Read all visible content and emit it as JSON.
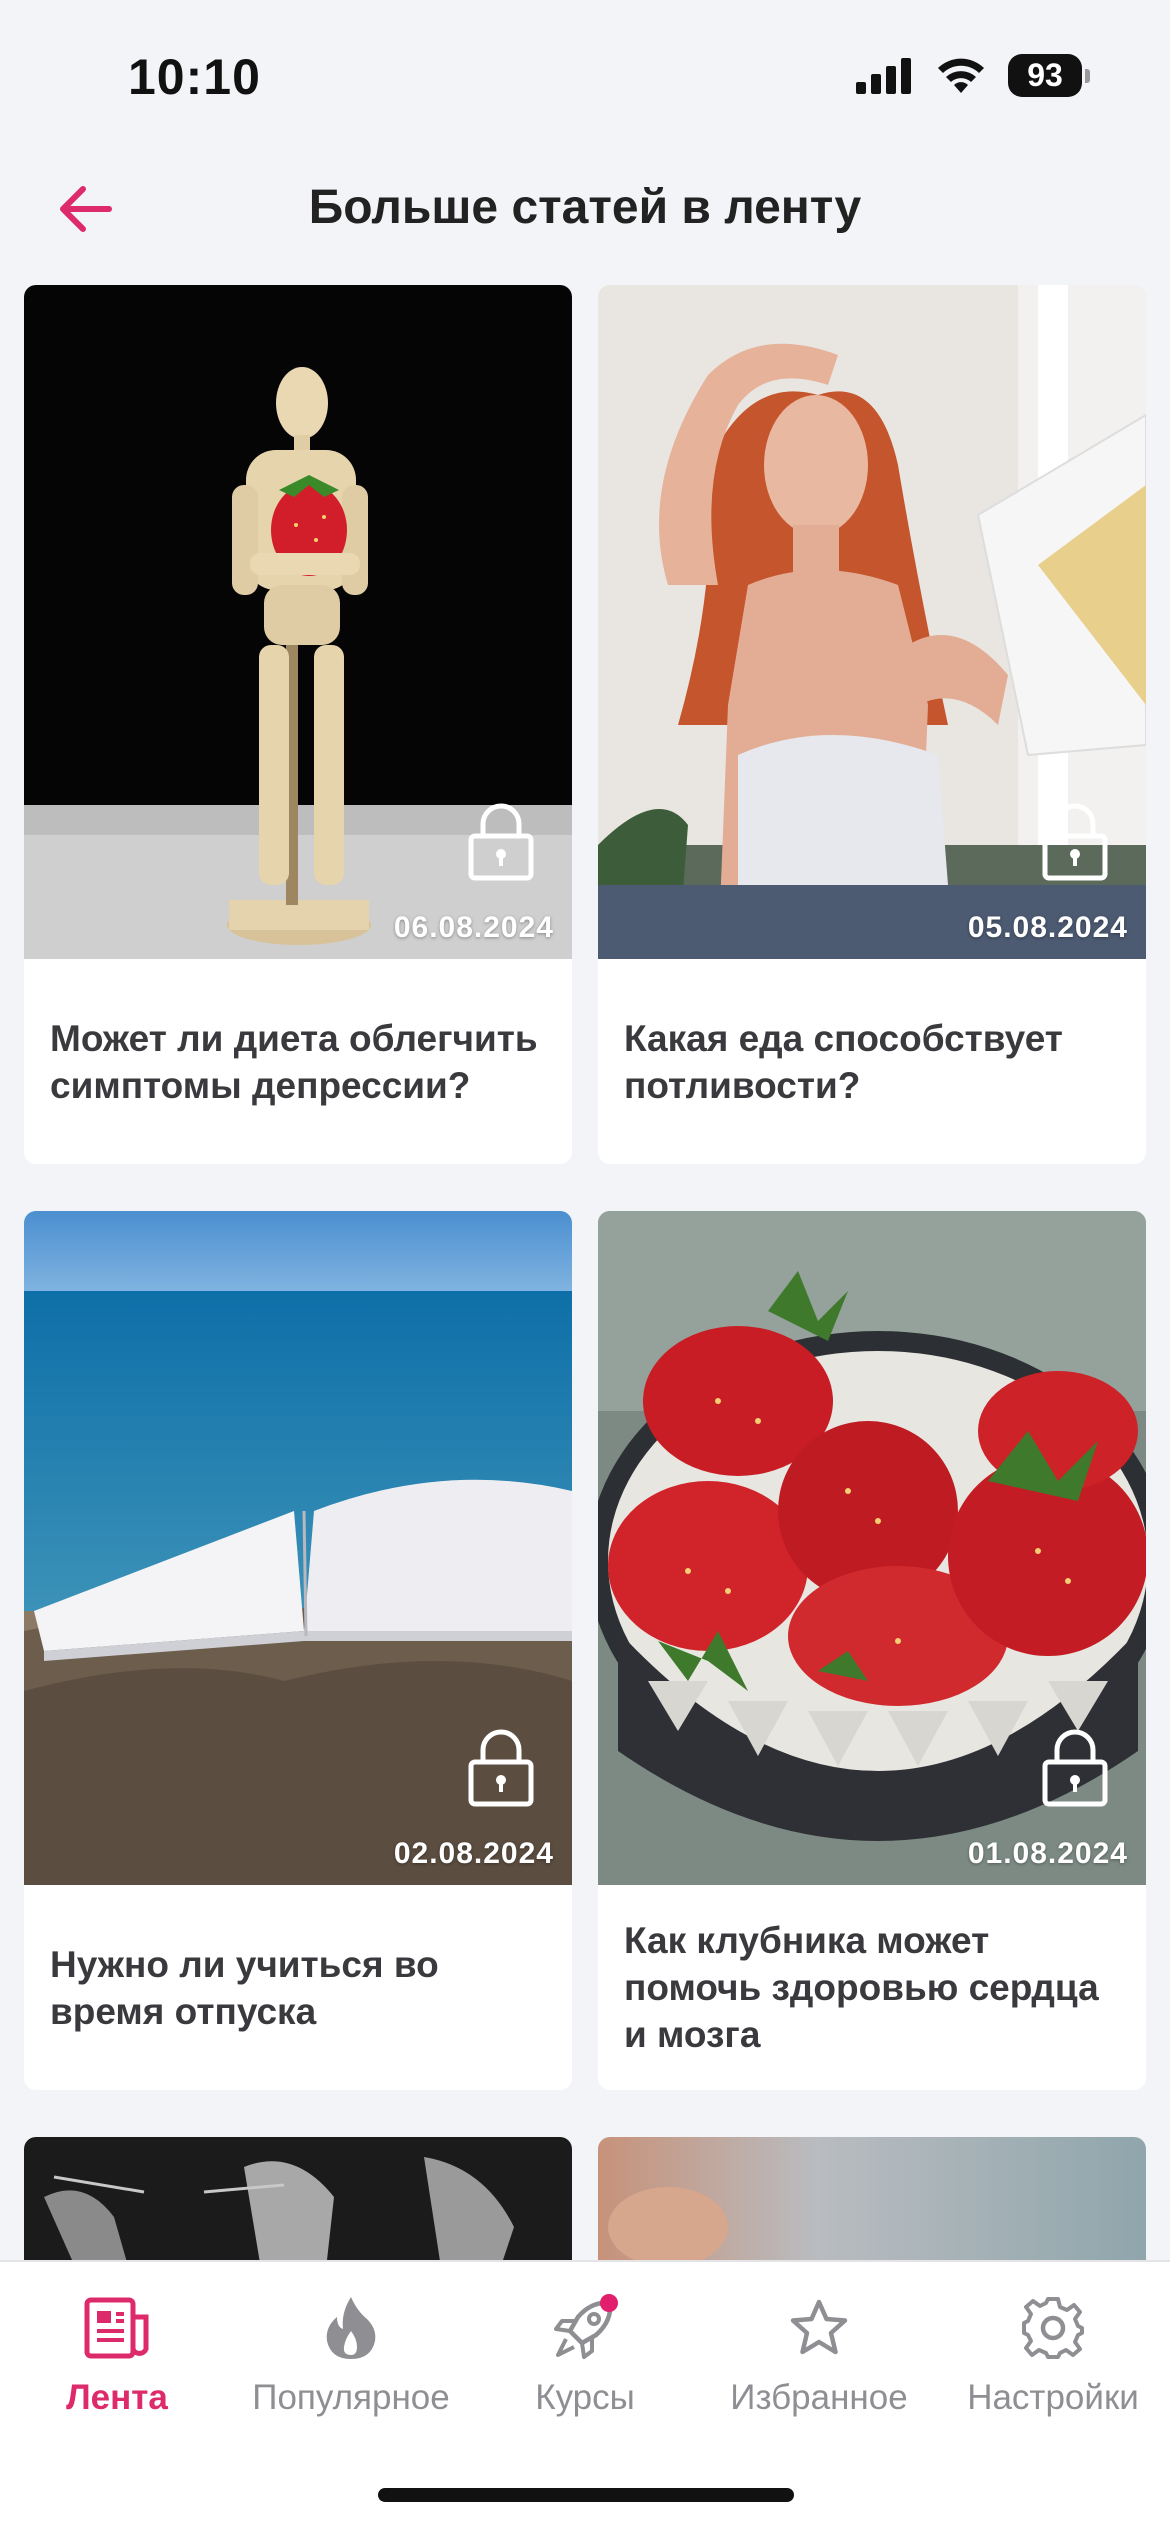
{
  "status": {
    "time": "10:10",
    "battery": "93",
    "icons": [
      "signal-icon",
      "wifi-icon",
      "battery-icon"
    ]
  },
  "header": {
    "title": "Больше статей в ленту",
    "back_icon": "arrow-left-icon"
  },
  "colors": {
    "accent": "#dd2a6a",
    "background": "#f3f4f7",
    "inactive": "#8e8e93"
  },
  "articles": [
    {
      "date": "06.08.2024",
      "title": "Может ли диета облегчить симптомы депрессии?",
      "locked": true,
      "image": "wooden mannequin holding strawberry"
    },
    {
      "date": "05.08.2024",
      "title": "Какая еда способствует потливости?",
      "locked": true,
      "image": "woman with fan"
    },
    {
      "date": "02.08.2024",
      "title": "Нужно ли учиться во время отпуска",
      "locked": true,
      "image": "open book on beach"
    },
    {
      "date": "01.08.2024",
      "title": "Как клубника может помочь здоровью сердца и мозга",
      "locked": true,
      "image": "bowl of strawberries"
    },
    {
      "date": "",
      "title": "",
      "locked": false,
      "image": "hands black and white"
    },
    {
      "date": "",
      "title": "",
      "locked": false,
      "image": "blurred photo"
    }
  ],
  "tabs": [
    {
      "label": "Лента",
      "icon": "news-icon",
      "active": true
    },
    {
      "label": "Популярное",
      "icon": "flame-icon",
      "active": false
    },
    {
      "label": "Курсы",
      "icon": "rocket-icon",
      "active": false,
      "badge": true
    },
    {
      "label": "Избранное",
      "icon": "star-icon",
      "active": false
    },
    {
      "label": "Настройки",
      "icon": "gear-icon",
      "active": false
    }
  ]
}
